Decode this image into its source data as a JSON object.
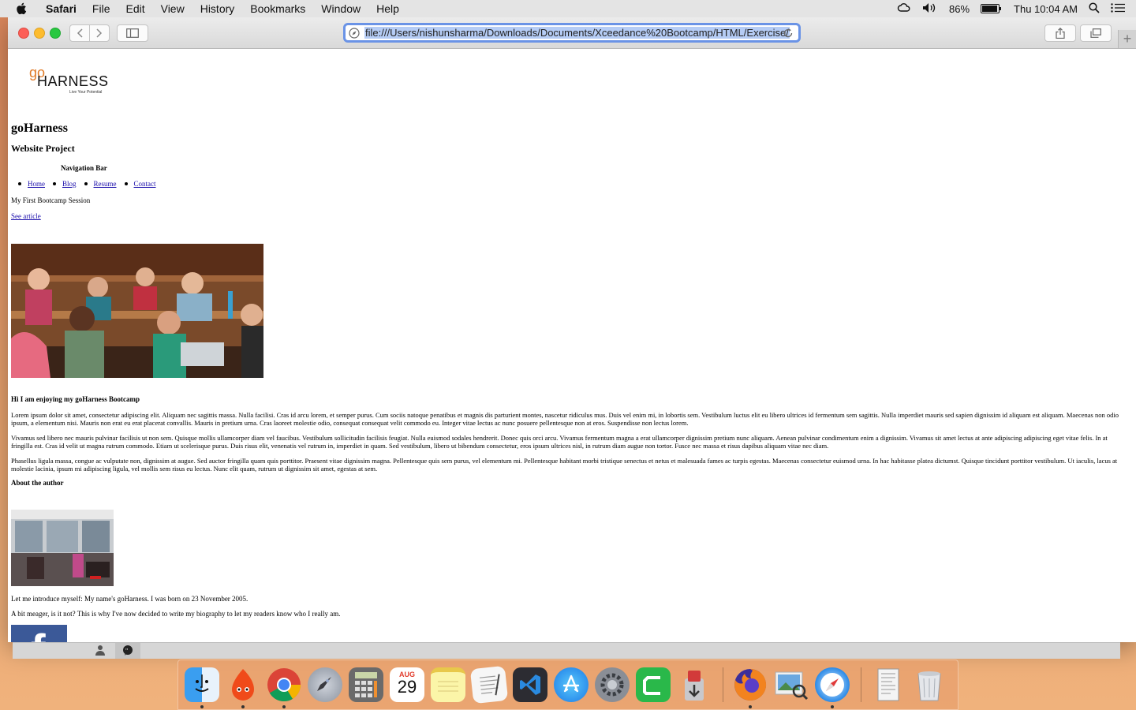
{
  "menubar": {
    "app_name": "Safari",
    "menus": [
      "File",
      "Edit",
      "View",
      "History",
      "Bookmarks",
      "Window",
      "Help"
    ],
    "battery_percent": "86%",
    "battery_level": 0.86,
    "clock": "Thu 10:04 AM"
  },
  "browser": {
    "url": "file:///Users/nishunsharma/Downloads/Documents/Xceedance%20Bootcamp/HTML/Exercise/"
  },
  "page": {
    "logo": {
      "go": "go",
      "harness": "HARNESS",
      "tagline": "Live Your Potential"
    },
    "title": "goHarness",
    "subtitle": "Website Project",
    "nav_title": "Navigation Bar",
    "nav_items": [
      "Home",
      "Blog",
      "Resume",
      "Contact"
    ],
    "session": "My First Bootcamp Session",
    "see_article": "See article ",
    "article_heading": "Hi I am enjoying my goHarness Bootcamp",
    "paragraphs": [
      "Lorem ipsum dolor sit amet, consectetur adipiscing elit. Aliquam nec sagittis massa. Nulla facilisi. Cras id arcu lorem, et semper purus. Cum sociis natoque penatibus et magnis dis parturient montes, nascetur ridiculus mus. Duis vel enim mi, in lobortis sem. Vestibulum luctus elit eu libero ultrices id fermentum sem sagittis. Nulla imperdiet mauris sed sapien dignissim id aliquam est aliquam. Maecenas non odio ipsum, a elementum nisi. Mauris non erat eu erat placerat convallis. Mauris in pretium urna. Cras laoreet molestie odio, consequat consequat velit commodo eu. Integer vitae lectus ac nunc posuere pellentesque non at eros. Suspendisse non lectus lorem.",
      "Vivamus sed libero nec mauris pulvinar facilisis ut non sem. Quisque mollis ullamcorper diam vel faucibus. Vestibulum sollicitudin facilisis feugiat. Nulla euismod sodales hendrerit. Donec quis orci arcu. Vivamus fermentum magna a erat ullamcorper dignissim pretium nunc aliquam. Aenean pulvinar condimentum enim a dignissim. Vivamus sit amet lectus at ante adipiscing adipiscing eget vitae felis. In at fringilla est. Cras id velit ut magna rutrum commodo. Etiam ut scelerisque purus. Duis risus elit, venenatis vel rutrum in, imperdiet in quam. Sed vestibulum, libero ut bibendum consectetur, eros ipsum ultrices nisl, in rutrum diam augue non tortor. Fusce nec massa et risus dapibus aliquam vitae nec diam.",
      "Phasellus ligula massa, congue ac vulputate non, dignissim at augue. Sed auctor fringilla quam quis porttitor. Praesent vitae dignissim magna. Pellentesque quis sem purus, vel elementum mi. Pellentesque habitant morbi tristique senectus et netus et malesuada fames ac turpis egestas. Maecenas consectetur euismod urna. In hac habitasse platea dictumst. Quisque tincidunt porttitor vestibulum. Ut iaculis, lacus at molestie lacinia, ipsum mi adipiscing ligula, vel mollis sem risus eu lectus. Nunc elit quam, rutrum ut dignissim sit amet, egestas at sem."
    ],
    "about_heading": "About the author",
    "intro": "Let me introduce myself: My name's goHarness. I was born on 23 November 2005.",
    "bio": "A bit meager, is it not? This is why I've now decided to write my biography to let my readers know who I really am.",
    "facebook_glyph": "f"
  },
  "dock": {
    "calendar_month": "AUG",
    "calendar_day": "29",
    "apps": [
      "finder",
      "hotspot-shield",
      "chrome",
      "launchpad",
      "calculator",
      "calendar",
      "notes",
      "textedit",
      "vscode",
      "app-store",
      "system-preferences",
      "camtasia",
      "git-tool",
      "firefox",
      "preview",
      "safari",
      "documents",
      "trash"
    ]
  },
  "colors": {
    "url_focus": "#6a93e6",
    "link": "#1a0dab",
    "facebook": "#3b5998",
    "logo_orange": "#e07b28"
  }
}
